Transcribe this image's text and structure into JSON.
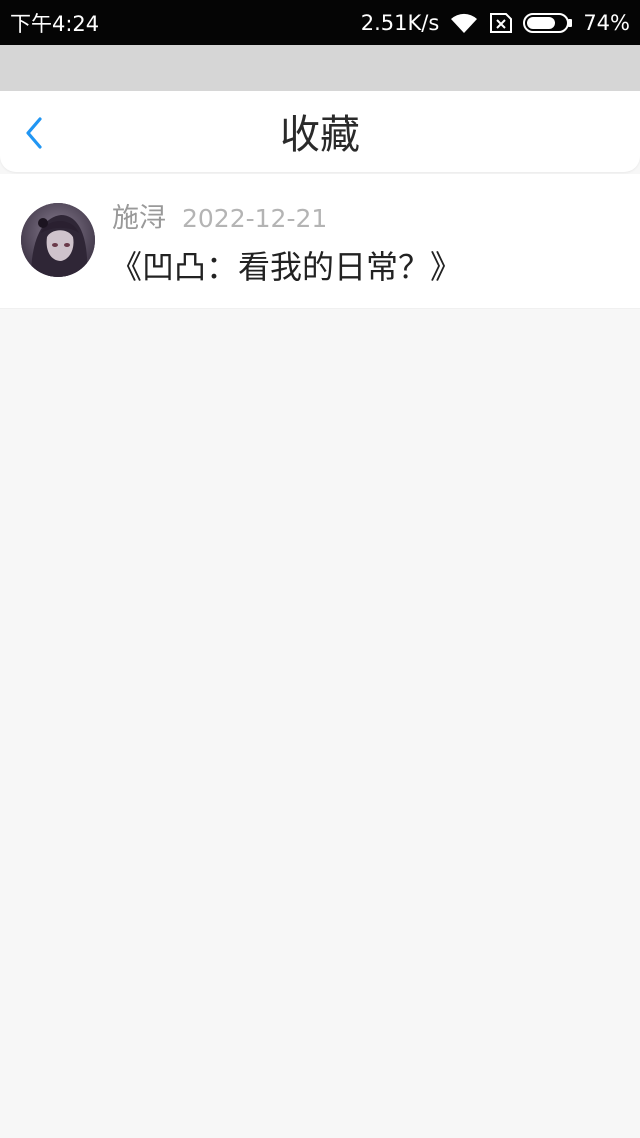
{
  "status_bar": {
    "time": "下午4:24",
    "network_speed": "2.51K/s",
    "battery_percent": "74%",
    "battery_level": 0.74,
    "icons": [
      "wifi-icon",
      "no-sim-icon",
      "battery-icon"
    ]
  },
  "header": {
    "back_icon": "chevron-left-icon",
    "title": "收藏",
    "accent_color": "#2196f3"
  },
  "favorites": [
    {
      "author": "施浔",
      "date": "2022-12-21",
      "title": "《凹凸：看我的日常？》",
      "avatar_icon": "avatar"
    }
  ]
}
